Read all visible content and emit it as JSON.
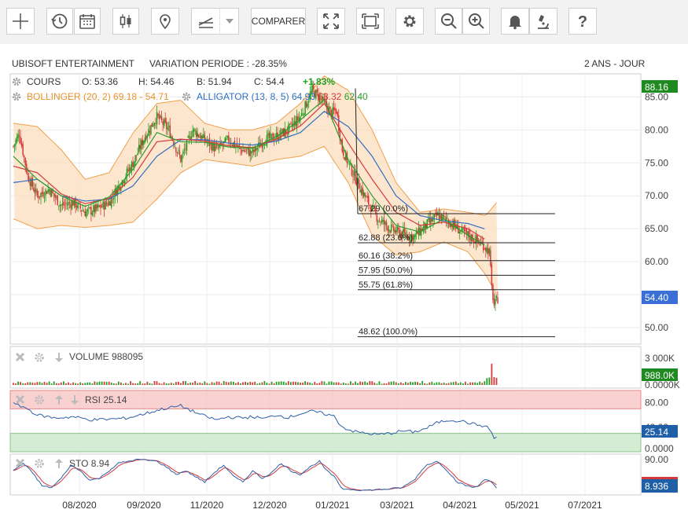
{
  "toolbar": {
    "buttons": [
      {
        "icon": "crosshair-icon"
      },
      {
        "icon": "history-clock-icon"
      },
      {
        "icon": "calendar-icon"
      },
      {
        "icon": "candlestick-icon"
      },
      {
        "icon": "map-pin-icon"
      },
      {
        "icon": "drawing-tool-icon"
      },
      {
        "icon": "chevron-down-icon"
      },
      {
        "icon": "expand-icon"
      },
      {
        "icon": "fullscreen-frame-icon"
      },
      {
        "icon": "gear-icon"
      },
      {
        "icon": "zoom-out-icon"
      },
      {
        "icon": "zoom-in-icon"
      },
      {
        "icon": "bell-icon"
      },
      {
        "icon": "microscope-icon"
      },
      {
        "icon": "help-icon"
      }
    ],
    "compare_label": "COMPARER"
  },
  "header": {
    "company": "UBISOFT ENTERTAINMENT",
    "variation": "VARIATION PERIODE : -28.35%",
    "period": "2 ANS - JOUR"
  },
  "legend": {
    "cours_label": "COURS",
    "open": "O: 53.36",
    "high": "H: 54.46",
    "low": "B: 51.94",
    "close": "C: 54.4",
    "change": "+1.83%",
    "bollinger_label": "BOLLINGER (20, 2) 69.18 - 54.71",
    "alligator_label": "ALLIGATOR (13, 8, 5)",
    "alligator_jaw": "64.93",
    "alligator_teeth": "63.32",
    "alligator_lips": "62.40"
  },
  "colors": {
    "up": "#22a022",
    "down": "#d43a3a",
    "bollinger": "#f0a04b",
    "jaw": "#2f6ec1",
    "teeth": "#d43a3a",
    "lips": "#2e9a2e",
    "rsi_line": "#2f5fa8",
    "sto_k": "#2f5fa8",
    "sto_d": "#d43a3a"
  },
  "chart_data": [
    {
      "type": "candlestick",
      "title": "UBISOFT ENTERTAINMENT",
      "ylim": [
        47.5,
        88.5
      ],
      "y_ticks": [
        "85.00",
        "80.00",
        "75.00",
        "70.00",
        "65.00",
        "60.00",
        "55.00",
        "50.00"
      ],
      "x_ticks": [
        "08/2020",
        "09/2020",
        "11/2020",
        "12/2020",
        "01/2021",
        "03/2021",
        "04/2021",
        "05/2021",
        "07/2021"
      ],
      "last_price_badge": "54.40",
      "high_badge": "88.16",
      "fibonacci": [
        {
          "label": "67.29 (0.0%)",
          "value": 67.29
        },
        {
          "label": "62.88 (23.6%)",
          "value": 62.88
        },
        {
          "label": "60.16 (38.2%)",
          "value": 60.16
        },
        {
          "label": "57.95 (50.0%)",
          "value": 57.95
        },
        {
          "label": "55.75 (61.8%)",
          "value": 55.75
        },
        {
          "label": "48.62 (100.0%)",
          "value": 48.62
        }
      ],
      "close_path": [
        [
          0,
          77.5
        ],
        [
          5,
          79.5
        ],
        [
          12,
          73
        ],
        [
          20,
          70
        ],
        [
          30,
          71
        ],
        [
          40,
          68.5
        ],
        [
          50,
          69
        ],
        [
          60,
          67.5
        ],
        [
          70,
          68
        ],
        [
          80,
          69
        ],
        [
          90,
          72
        ],
        [
          100,
          75
        ],
        [
          110,
          79
        ],
        [
          120,
          82
        ],
        [
          130,
          80
        ],
        [
          140,
          75.5
        ],
        [
          150,
          80
        ],
        [
          160,
          78.5
        ],
        [
          170,
          77
        ],
        [
          180,
          78.5
        ],
        [
          190,
          77
        ],
        [
          200,
          76.5
        ],
        [
          210,
          78.5
        ],
        [
          220,
          79
        ],
        [
          230,
          80
        ],
        [
          240,
          82
        ],
        [
          250,
          86
        ],
        [
          258,
          84.5
        ],
        [
          266,
          82.5
        ],
        [
          270,
          83
        ],
        [
          275,
          77
        ],
        [
          285,
          73
        ],
        [
          295,
          69.5
        ],
        [
          305,
          66.5
        ],
        [
          315,
          65
        ],
        [
          325,
          64.2
        ],
        [
          335,
          63.8
        ],
        [
          345,
          65.5
        ],
        [
          355,
          67
        ],
        [
          365,
          66
        ],
        [
          375,
          64.5
        ],
        [
          385,
          63.5
        ],
        [
          393,
          62.5
        ],
        [
          398,
          61.5
        ],
        [
          400,
          56
        ],
        [
          402,
          53.3
        ],
        [
          405,
          54.4
        ]
      ],
      "jaw_path": [
        [
          0,
          72
        ],
        [
          20,
          72.5
        ],
        [
          40,
          70
        ],
        [
          60,
          69.2
        ],
        [
          80,
          69.5
        ],
        [
          100,
          71.5
        ],
        [
          120,
          76
        ],
        [
          140,
          78.5
        ],
        [
          160,
          78.5
        ],
        [
          180,
          78
        ],
        [
          200,
          77.7
        ],
        [
          220,
          78.3
        ],
        [
          240,
          79.6
        ],
        [
          260,
          82.8
        ],
        [
          280,
          80.5
        ],
        [
          300,
          76
        ],
        [
          320,
          70
        ],
        [
          340,
          67
        ],
        [
          360,
          66.2
        ],
        [
          380,
          65.8
        ],
        [
          395,
          64.93
        ]
      ],
      "teeth_path": [
        [
          0,
          74.5
        ],
        [
          20,
          73.5
        ],
        [
          40,
          70.3
        ],
        [
          60,
          68.8
        ],
        [
          80,
          69.6
        ],
        [
          100,
          72.8
        ],
        [
          120,
          78.2
        ],
        [
          140,
          78.6
        ],
        [
          160,
          78.3
        ],
        [
          180,
          77.6
        ],
        [
          200,
          77.3
        ],
        [
          220,
          78.6
        ],
        [
          240,
          80.6
        ],
        [
          260,
          84
        ],
        [
          280,
          78
        ],
        [
          300,
          72.5
        ],
        [
          320,
          67.5
        ],
        [
          340,
          65.5
        ],
        [
          360,
          66
        ],
        [
          380,
          65
        ],
        [
          395,
          63.32
        ]
      ],
      "lips_path": [
        [
          0,
          76
        ],
        [
          20,
          72.5
        ],
        [
          40,
          70
        ],
        [
          60,
          68.4
        ],
        [
          80,
          69.8
        ],
        [
          100,
          74
        ],
        [
          120,
          79.6
        ],
        [
          140,
          78.2
        ],
        [
          160,
          78.1
        ],
        [
          180,
          77.4
        ],
        [
          200,
          77.2
        ],
        [
          220,
          79
        ],
        [
          240,
          81.5
        ],
        [
          260,
          84.6
        ],
        [
          280,
          75.5
        ],
        [
          300,
          70
        ],
        [
          320,
          65.5
        ],
        [
          340,
          64.5
        ],
        [
          360,
          66.5
        ],
        [
          380,
          64
        ],
        [
          395,
          62.4
        ]
      ],
      "bollinger_upper_path": [
        [
          0,
          81
        ],
        [
          20,
          80.5
        ],
        [
          40,
          77
        ],
        [
          60,
          72.5
        ],
        [
          80,
          73.5
        ],
        [
          100,
          79.5
        ],
        [
          120,
          84
        ],
        [
          140,
          84.5
        ],
        [
          160,
          81
        ],
        [
          180,
          80
        ],
        [
          200,
          80
        ],
        [
          220,
          81
        ],
        [
          240,
          84
        ],
        [
          260,
          88.2
        ],
        [
          280,
          86
        ],
        [
          300,
          80
        ],
        [
          320,
          72
        ],
        [
          340,
          67.5
        ],
        [
          360,
          68
        ],
        [
          380,
          67.5
        ],
        [
          395,
          67
        ],
        [
          405,
          69.18
        ]
      ],
      "bollinger_lower_path": [
        [
          0,
          66.5
        ],
        [
          20,
          65
        ],
        [
          40,
          65.5
        ],
        [
          60,
          65.2
        ],
        [
          80,
          65.5
        ],
        [
          100,
          66
        ],
        [
          120,
          69.5
        ],
        [
          140,
          73.5
        ],
        [
          160,
          75.5
        ],
        [
          180,
          75
        ],
        [
          200,
          74.5
        ],
        [
          220,
          75.5
        ],
        [
          240,
          76
        ],
        [
          260,
          77.5
        ],
        [
          280,
          72
        ],
        [
          300,
          64
        ],
        [
          320,
          61
        ],
        [
          340,
          61.5
        ],
        [
          360,
          63
        ],
        [
          380,
          61.5
        ],
        [
          395,
          58
        ],
        [
          405,
          54.71
        ]
      ]
    },
    {
      "type": "bar",
      "title": "VOLUME",
      "last_value": "988095",
      "y_ticks": [
        "3 000K",
        "0.0000K"
      ],
      "last_badge": "988.0K",
      "max": 3000000
    },
    {
      "type": "line",
      "title": "RSI",
      "last_value": "25.14",
      "y_ticks": [
        "80.00",
        "40.00",
        "0.0000"
      ],
      "ylim": [
        0,
        100
      ],
      "last_badge": "25.14",
      "path": [
        [
          0,
          78
        ],
        [
          10,
          72
        ],
        [
          20,
          60
        ],
        [
          35,
          55
        ],
        [
          50,
          57
        ],
        [
          65,
          52
        ],
        [
          80,
          53
        ],
        [
          95,
          55
        ],
        [
          110,
          62
        ],
        [
          125,
          70
        ],
        [
          140,
          75
        ],
        [
          150,
          66
        ],
        [
          160,
          58
        ],
        [
          170,
          52
        ],
        [
          180,
          57
        ],
        [
          190,
          55
        ],
        [
          200,
          57
        ],
        [
          210,
          54
        ],
        [
          220,
          60
        ],
        [
          230,
          56
        ],
        [
          240,
          62
        ],
        [
          250,
          66
        ],
        [
          260,
          62
        ],
        [
          268,
          58
        ],
        [
          275,
          40
        ],
        [
          285,
          33
        ],
        [
          295,
          30
        ],
        [
          305,
          28
        ],
        [
          315,
          30
        ],
        [
          325,
          34
        ],
        [
          335,
          32
        ],
        [
          345,
          38
        ],
        [
          355,
          48
        ],
        [
          365,
          52
        ],
        [
          375,
          50
        ],
        [
          385,
          45
        ],
        [
          393,
          42
        ],
        [
          398,
          38
        ],
        [
          402,
          22
        ],
        [
          405,
          25.14
        ]
      ]
    },
    {
      "type": "line",
      "title": "STO",
      "last_value": "8.94",
      "y_ticks": [
        "90.00"
      ],
      "ylim": [
        0,
        100
      ],
      "last_badge": "8.936",
      "k_path": [
        [
          0,
          60
        ],
        [
          8,
          80
        ],
        [
          16,
          55
        ],
        [
          24,
          20
        ],
        [
          32,
          15
        ],
        [
          40,
          40
        ],
        [
          48,
          75
        ],
        [
          56,
          60
        ],
        [
          64,
          35
        ],
        [
          72,
          40
        ],
        [
          80,
          60
        ],
        [
          88,
          80
        ],
        [
          96,
          85
        ],
        [
          104,
          90
        ],
        [
          112,
          88
        ],
        [
          120,
          85
        ],
        [
          128,
          70
        ],
        [
          136,
          50
        ],
        [
          144,
          60
        ],
        [
          152,
          45
        ],
        [
          160,
          30
        ],
        [
          168,
          55
        ],
        [
          176,
          75
        ],
        [
          184,
          45
        ],
        [
          192,
          30
        ],
        [
          200,
          60
        ],
        [
          208,
          40
        ],
        [
          216,
          55
        ],
        [
          224,
          80
        ],
        [
          232,
          60
        ],
        [
          240,
          50
        ],
        [
          248,
          70
        ],
        [
          256,
          85
        ],
        [
          262,
          60
        ],
        [
          268,
          45
        ],
        [
          275,
          12
        ],
        [
          285,
          10
        ],
        [
          295,
          8
        ],
        [
          305,
          10
        ],
        [
          315,
          12
        ],
        [
          325,
          15
        ],
        [
          335,
          35
        ],
        [
          345,
          75
        ],
        [
          355,
          85
        ],
        [
          363,
          60
        ],
        [
          371,
          30
        ],
        [
          379,
          20
        ],
        [
          387,
          15
        ],
        [
          395,
          40
        ],
        [
          400,
          30
        ],
        [
          405,
          8.94
        ]
      ]
    }
  ]
}
